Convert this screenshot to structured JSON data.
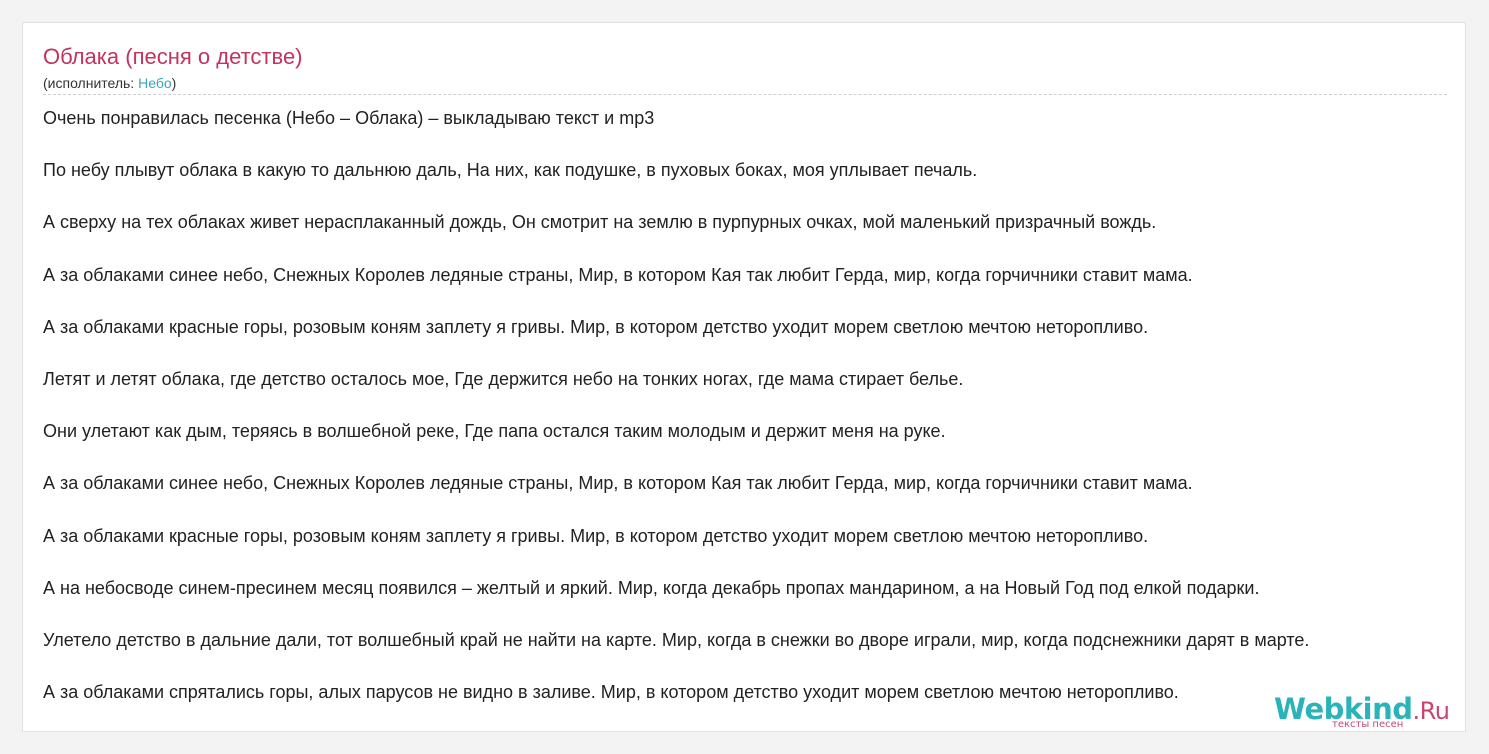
{
  "song": {
    "title": "Облака (песня о детстве)",
    "performer_prefix": "(исполнитель: ",
    "performer_name": "Небо",
    "performer_suffix": ")"
  },
  "lyrics": [
    "Очень понравилась песенка (Небо – Облака) – выкладываю текст и mp3",
    "По небу плывут облака в какую то дальнюю даль, На них, как подушке, в пуховых боках, моя уплывает печаль.",
    "А сверху на тех облаках живет нерасплаканный дождь, Он смотрит на землю в пурпурных очках, мой маленький призрачный вождь.",
    "А за облаками синее небо, Снежных Королев ледяные страны, Мир, в котором Кая так любит Герда, мир, когда горчичники ставит мама.",
    "А за облаками красные горы, розовым коням заплету я гривы. Мир, в котором детство уходит морем светлою мечтою неторопливо.",
    "Летят и летят облака, где детство осталось мое, Где держится небо на тонких ногах, где мама стирает белье.",
    "Они улетают как дым, теряясь в волшебной реке, Где папа остался таким молодым и держит меня на руке.",
    "А за облаками синее небо, Снежных Королев ледяные страны, Мир, в котором Кая так любит Герда, мир, когда горчичники ставит мама.",
    "А за облаками красные горы, розовым коням заплету я гривы. Мир, в котором детство уходит морем светлою мечтою неторопливо.",
    "А на небосводе синем-пресинем месяц появился – желтый и яркий. Мир, когда декабрь пропах мандарином, а на Новый Год под елкой подарки.",
    "Улетело детство в дальние дали, тот волшебный край не найти на карте. Мир, когда в снежки во дворе играли, мир, когда подснежники дарят в марте.",
    "А за облаками спрятались горы, алых парусов не видно в заливе. Мир, в котором детство уходит морем светлою мечтою неторопливо."
  ],
  "watermark": {
    "brand": "Webkind",
    "tld": ".Ru",
    "tagline": "тексты песен"
  },
  "colors": {
    "title": "#c2335e",
    "link": "#3aa6b8",
    "brand": "#2ab3b8",
    "brand_accent": "#c8466e"
  }
}
